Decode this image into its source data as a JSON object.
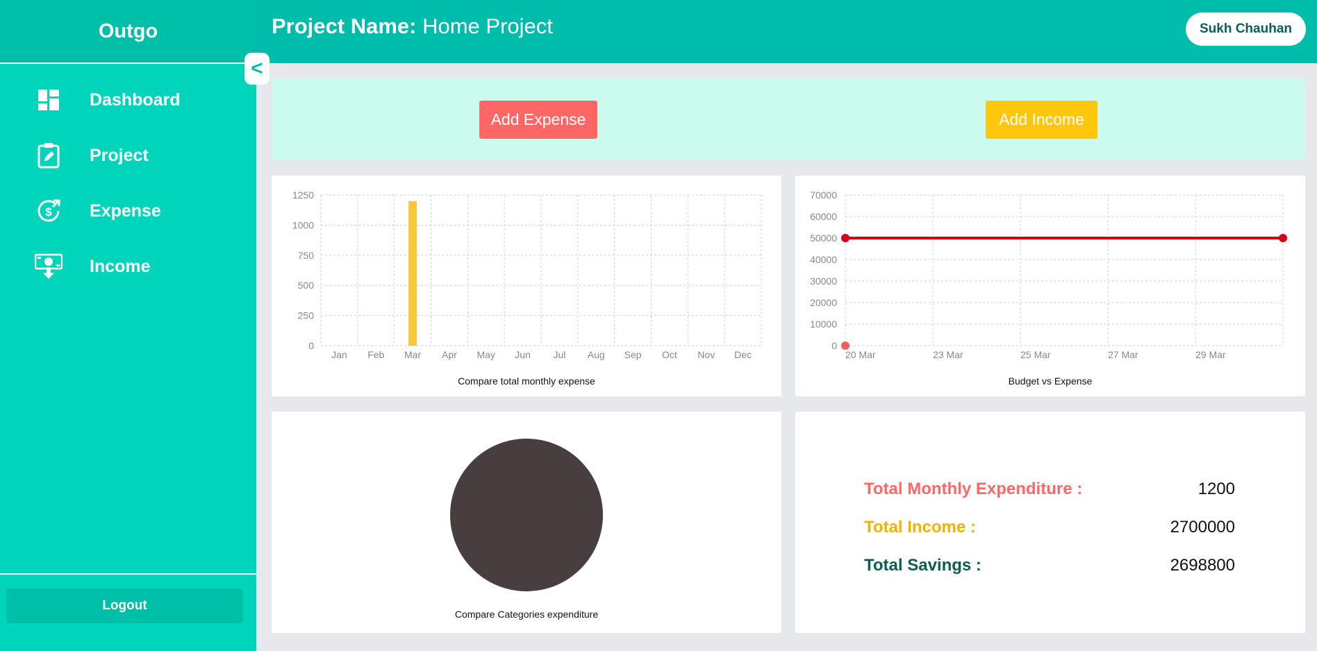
{
  "sidebar": {
    "brand": "Outgo",
    "collapse_label": "<",
    "items": [
      {
        "label": "Dashboard",
        "icon": "dashboard-icon"
      },
      {
        "label": "Project",
        "icon": "clipboard-edit-icon"
      },
      {
        "label": "Expense",
        "icon": "dollar-cycle-icon"
      },
      {
        "label": "Income",
        "icon": "money-download-icon"
      }
    ],
    "logout_label": "Logout"
  },
  "header": {
    "project_label": "Project Name:",
    "project_name": "Home Project",
    "user_name": "Sukh Chauhan"
  },
  "actions": {
    "add_expense_label": "Add Expense",
    "add_income_label": "Add Income"
  },
  "colors": {
    "sidebar": "#00d5bc",
    "header": "#00bcaa",
    "expense": "#ff6766",
    "income": "#ffc70b",
    "savings": "#0a5e57",
    "bar": "#f8c83a",
    "line": "#d0021b",
    "pie": "#483e40"
  },
  "chart_data": [
    {
      "type": "bar",
      "title": "Compare total monthly expense",
      "categories": [
        "Jan",
        "Feb",
        "Mar",
        "Apr",
        "May",
        "Jun",
        "Jul",
        "Aug",
        "Sep",
        "Oct",
        "Nov",
        "Dec"
      ],
      "values": [
        0,
        0,
        1200,
        0,
        0,
        0,
        0,
        0,
        0,
        0,
        0,
        0
      ],
      "ylim": [
        0,
        1250
      ],
      "yticks": [
        0,
        250,
        500,
        750,
        1000,
        1250
      ],
      "grid": true
    },
    {
      "type": "line",
      "title": "Budget vs Expense",
      "x_ticks": [
        "20 Mar",
        "23 Mar",
        "25 Mar",
        "27 Mar",
        "29 Mar"
      ],
      "ylim": [
        0,
        70000
      ],
      "yticks": [
        0,
        10000,
        20000,
        30000,
        40000,
        50000,
        60000,
        70000
      ],
      "series": [
        {
          "points": [
            {
              "x": "20 Mar",
              "y": 50000
            },
            {
              "x": "end",
              "y": 50000
            }
          ]
        },
        {
          "points": [
            {
              "x": "20 Mar",
              "y": 0
            }
          ]
        }
      ],
      "grid": true
    },
    {
      "type": "pie",
      "title": "Compare Categories expenditure",
      "slices": [
        {
          "value": 100
        }
      ]
    }
  ],
  "stats": [
    {
      "label": "Total Monthly Expenditure :",
      "value": "1200"
    },
    {
      "label": "Total Income :",
      "value": "2700000"
    },
    {
      "label": "Total Savings :",
      "value": "2698800"
    }
  ]
}
